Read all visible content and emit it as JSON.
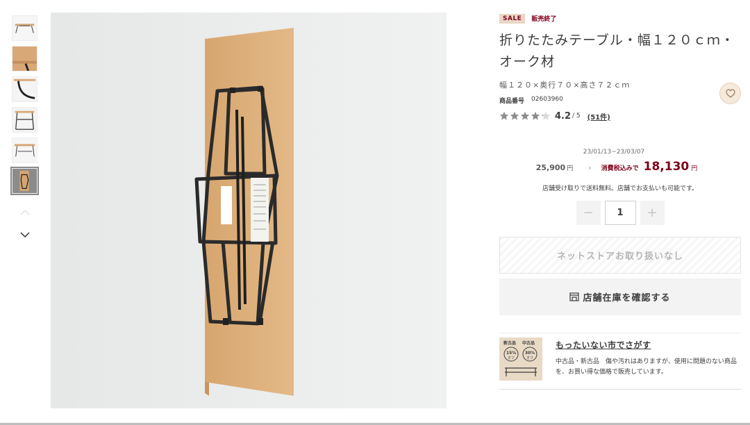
{
  "product": {
    "sale_badge": "SALE",
    "status_label": "販売終了",
    "title": "折りたたみテーブル・幅１２０ｃｍ・オーク材",
    "size": "幅１２０×奥行７０×高さ７２ｃｍ",
    "product_number_label": "商品番号",
    "product_number": "02603960",
    "rating": {
      "value": "4.2",
      "max": "/ 5",
      "count": "(51件)",
      "stars_filled": 4.2,
      "stars_total": 5
    }
  },
  "price": {
    "period": "23/01/13~23/03/07",
    "old_price": "25,900",
    "old_price_unit": "円",
    "arrow": "›",
    "tax_label": "消費税込みで",
    "new_price": "18,130",
    "new_price_unit": "円",
    "shipping_note": "店舗受け取りで送料無料。店舗でお支払いも可能です。"
  },
  "quantity": {
    "minus": "−",
    "value": "1",
    "plus": "+"
  },
  "buttons": {
    "cart_disabled": "ネットストアお取り扱いなし",
    "store_stock": "店舗在庫を確認する"
  },
  "outlet": {
    "title": "もったいない市でさがす",
    "description": "中古品・新古品　傷や汚れはありますが、使用に問題のない商品を、お買い得な価格で販売しています。",
    "badge_left_title": "新古品",
    "badge_left_pct": "15%",
    "badge_left_unit": "オフ",
    "badge_right_title": "中古品",
    "badge_right_pct": "30%",
    "badge_right_unit": "オフ"
  },
  "icons": {
    "favorite": "heart-icon",
    "store": "store-icon",
    "thumb_up": "chevron-up-icon",
    "thumb_down": "chevron-down-icon"
  },
  "colors": {
    "accent": "#7f0019",
    "sale_badge_bg": "#e9d7c6",
    "star_filled": "#8c8c8c",
    "star_empty": "#d9d9d9",
    "wood": "#d9a877"
  }
}
